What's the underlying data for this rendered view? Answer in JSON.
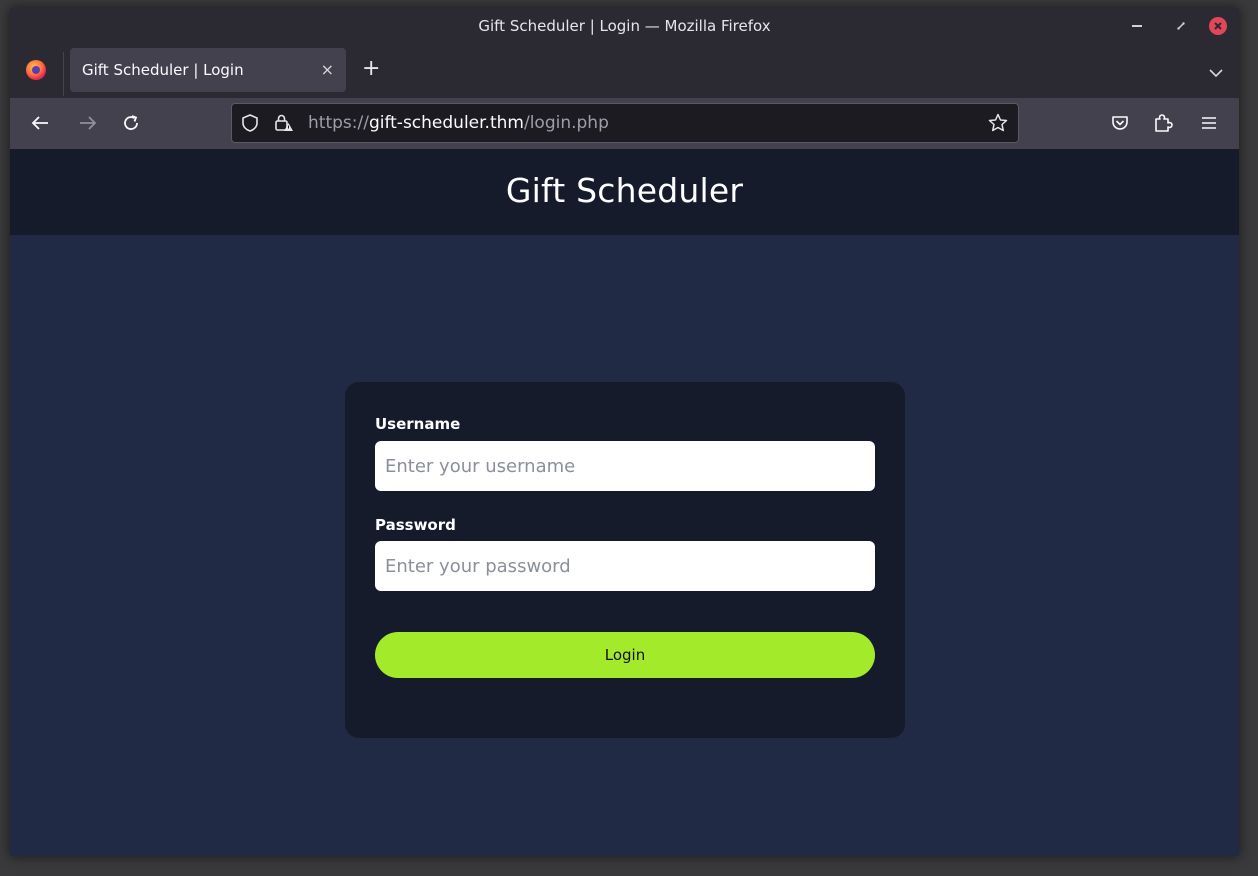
{
  "window": {
    "title": "Gift Scheduler | Login — Mozilla Firefox"
  },
  "tab": {
    "title": "Gift Scheduler | Login",
    "close_glyph": "×",
    "new_tab_glyph": "+"
  },
  "urlbar": {
    "scheme": "https://",
    "host": "gift-scheduler.thm",
    "path": "/login.php"
  },
  "page": {
    "header_title": "Gift Scheduler",
    "form": {
      "username_label": "Username",
      "username_placeholder": "Enter your username",
      "username_value": "",
      "password_label": "Password",
      "password_placeholder": "Enter your password",
      "password_value": "",
      "login_label": "Login"
    }
  },
  "colors": {
    "page_bg": "#212a44",
    "header_bg": "#161b2c",
    "card_bg": "#161b2c",
    "button_bg": "#a3ea2a",
    "close_button": "#e0485a"
  },
  "icons": {
    "browser_logo": "firefox-icon",
    "back": "arrow-left-icon",
    "forward": "arrow-right-icon",
    "reload": "reload-icon",
    "tracking": "shield-icon",
    "security": "lock-warning-icon",
    "bookmark": "star-icon",
    "pocket": "pocket-icon",
    "extensions": "puzzle-icon",
    "menu": "hamburger-icon",
    "tab_list": "chevron-down-icon"
  }
}
